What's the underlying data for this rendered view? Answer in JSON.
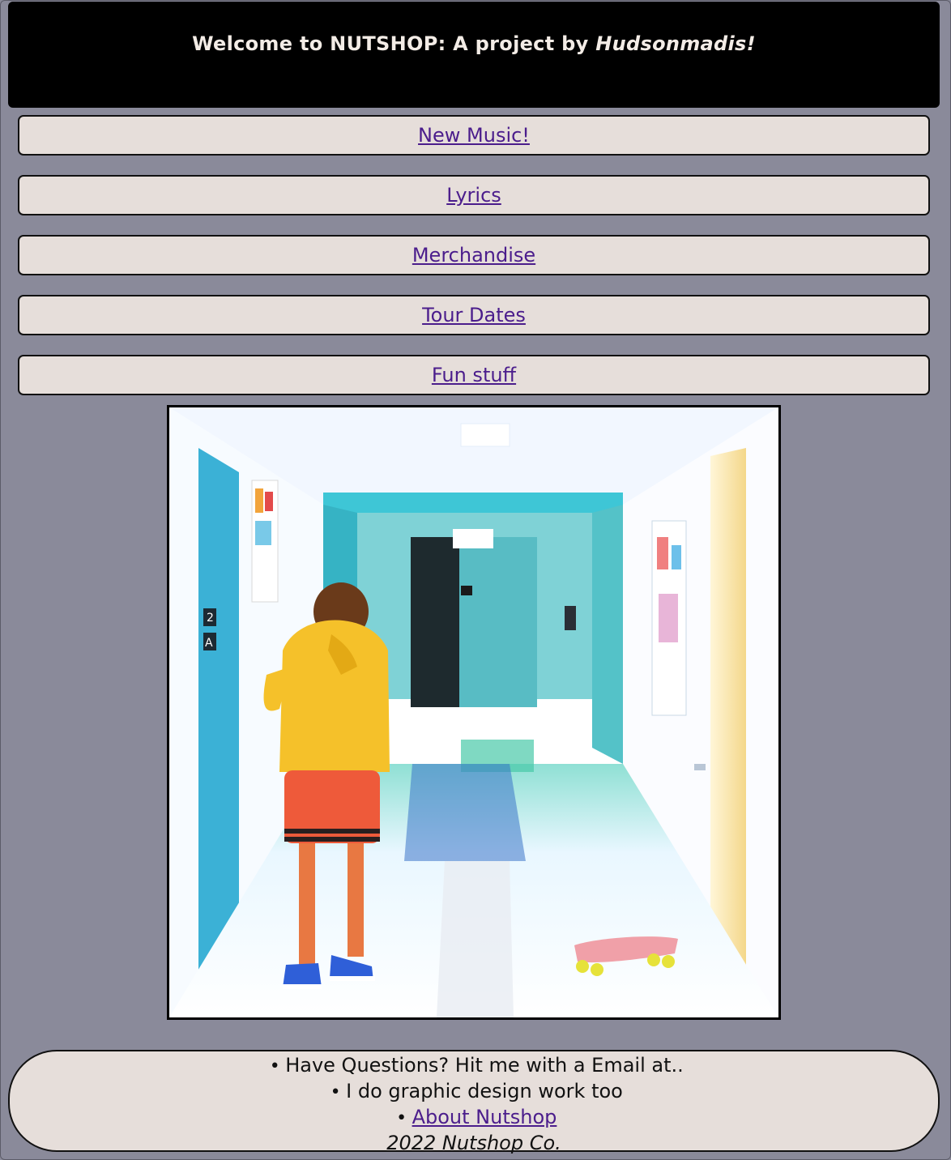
{
  "header": {
    "title_prefix": "Welcome to NUTSHOP: A project by ",
    "title_author": "Hudsonmadis!"
  },
  "nav": {
    "items": [
      {
        "label": "New Music!"
      },
      {
        "label": "Lyrics"
      },
      {
        "label": "Merchandise"
      },
      {
        "label": "Tour Dates"
      },
      {
        "label": "Fun stuff"
      }
    ]
  },
  "hero": {
    "alt": "Person in yellow hoodie and red shorts standing in a hallway with a skateboard"
  },
  "footer": {
    "items": [
      {
        "label": "Have Questions? Hit me with a Email at.."
      },
      {
        "label": "I do graphic design work too"
      },
      {
        "label": "About Nutshop"
      }
    ],
    "copyright": "2022 Nutshop Co."
  },
  "colors": {
    "page_background": "#8a8a9a",
    "header_background": "#000000",
    "panel_background": "#e6deda",
    "link": "#4b1d8c"
  }
}
